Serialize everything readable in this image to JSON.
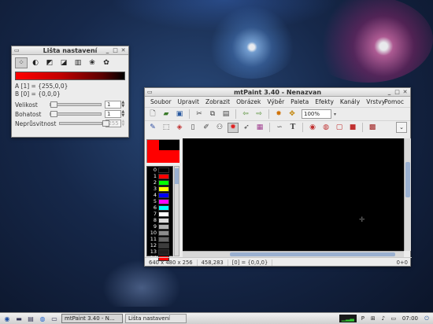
{
  "settings_window": {
    "title": "Lišta nastavení",
    "color_a": "A [1] = {255,0,0}",
    "color_b": "B [0] = {0,0,0}",
    "rows": [
      {
        "label": "Velikost",
        "value": "1",
        "enabled": true
      },
      {
        "label": "Bohatost",
        "value": "1",
        "enabled": true
      },
      {
        "label": "Neprůsvitnost",
        "value": "255",
        "enabled": false
      }
    ]
  },
  "main_window": {
    "title": "mtPaint 3.40 - Nenazvan",
    "menu": [
      "Soubor",
      "Upravit",
      "Zobrazit",
      "Obrázek",
      "Výběr",
      "Paleta",
      "Efekty",
      "Kanály",
      "Vrstvy"
    ],
    "help": "Pomoc",
    "zoom": "100%",
    "palette_indices": [
      "0",
      "1",
      "2",
      "3",
      "4",
      "5",
      "6",
      "7",
      "8",
      "9",
      "10",
      "11",
      "12",
      "13",
      "14"
    ],
    "palette_colors": [
      "#000000",
      "#ff0000",
      "#00ff00",
      "#ffff00",
      "#0000ff",
      "#ff00ff",
      "#00ffff",
      "#ffffff",
      "#dcdcdc",
      "#b4b4b4",
      "#8c8c8c",
      "#646464",
      "#3c3c3c",
      "#1e1e1e",
      "#ff0000"
    ],
    "status": {
      "size": "640 x 480 x 256",
      "coords": "458,283",
      "pixel": "[0] = {0,0,0}",
      "right": "0+0"
    }
  },
  "taskbar": {
    "tasks": [
      "mtPaint 3.40 - N...",
      "Lišta nastavení"
    ],
    "clock": "07:00"
  }
}
